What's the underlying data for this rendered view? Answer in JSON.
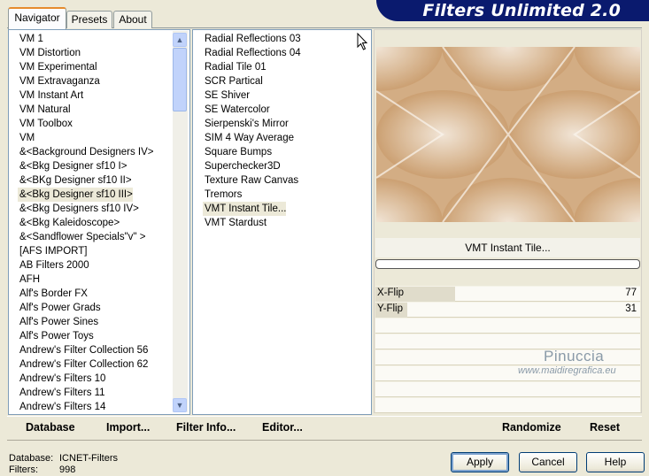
{
  "banner": {
    "title": "Filters Unlimited 2.0"
  },
  "tabs": [
    {
      "label": "Navigator",
      "active": true
    },
    {
      "label": "Presets",
      "active": false
    },
    {
      "label": "About",
      "active": false
    }
  ],
  "categories": [
    "VM 1",
    "VM Distortion",
    "VM Experimental",
    "VM Extravaganza",
    "VM Instant Art",
    "VM Natural",
    "VM Toolbox",
    "VM",
    "&<Background Designers IV>",
    "&<Bkg Designer sf10 I>",
    "&<BKg Designer sf10 II>",
    "&<Bkg Designer sf10 III>",
    "&<Bkg Designers sf10 IV>",
    "&<Bkg Kaleidoscope>",
    "&<Sandflower Specials\"v\" >",
    "[AFS IMPORT]",
    "AB Filters 2000",
    "AFH",
    "Alf's Border FX",
    "Alf's Power Grads",
    "Alf's Power Sines",
    "Alf's Power Toys",
    "Andrew's Filter Collection 56",
    "Andrew's Filter Collection 62",
    "Andrew's Filters 10",
    "Andrew's Filters 11",
    "Andrew's Filters 14"
  ],
  "selected_category": "&<Bkg Designer sf10 III>",
  "filters": [
    "Radial Reflections 03",
    "Radial Reflections 04",
    "Radial Tile 01",
    "SCR  Partical",
    "SE Shiver",
    "SE Watercolor",
    "Sierpenski's Mirror",
    "SIM 4 Way Average",
    "Square Bumps",
    "Superchecker3D",
    "Texture Raw Canvas",
    "Tremors",
    "VMT Instant Tile...",
    "VMT Stardust"
  ],
  "selected_filter": "VMT Instant Tile...",
  "filter_name": "VMT Instant Tile...",
  "params": [
    {
      "label": "X-Flip",
      "value": "77",
      "fraction": 0.3
    },
    {
      "label": "Y-Flip",
      "value": "31",
      "fraction": 0.12
    }
  ],
  "watermark": {
    "title": "Pinuccia",
    "url": "www.maidiregrafica.eu"
  },
  "toolbar": {
    "database": "Database",
    "import": "Import...",
    "filter_info": "Filter Info...",
    "editor": "Editor...",
    "randomize": "Randomize",
    "reset": "Reset"
  },
  "status": {
    "database_label": "Database:",
    "database_value": "ICNET-Filters",
    "filters_label": "Filters:",
    "filters_value": "998"
  },
  "buttons": {
    "apply": "Apply",
    "cancel": "Cancel",
    "help": "Help"
  },
  "colors": {
    "accent_dark": "#0a1a6e",
    "tile_light": "#f7efe5",
    "tile_dark": "#c69664"
  }
}
